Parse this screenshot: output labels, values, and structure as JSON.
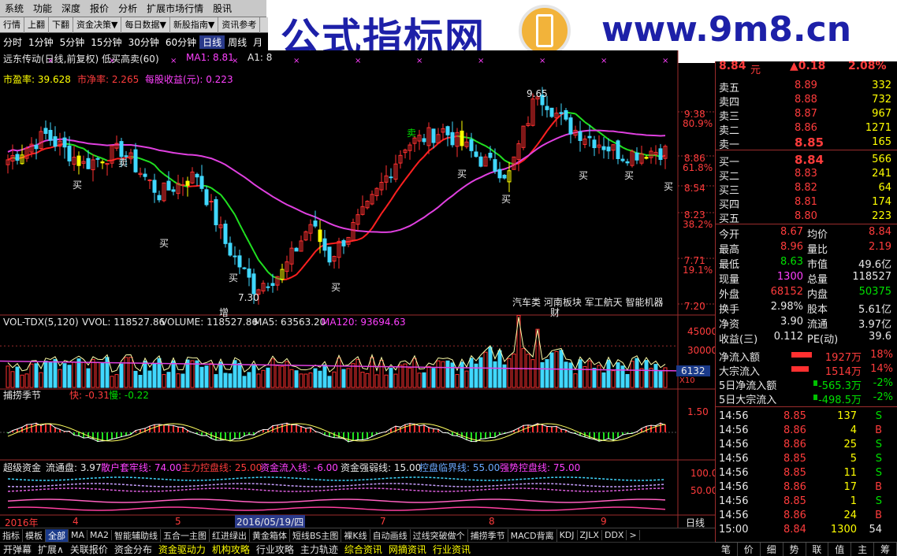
{
  "menubar": [
    "系统",
    "功能",
    "深度",
    "报价",
    "分析",
    "扩展市场行情",
    "股讯"
  ],
  "banner": {
    "title": "公式指标网",
    "url": "www.9m8.cn"
  },
  "toolbar": [
    "行情",
    "上翻",
    "下翻",
    "资金决策▼",
    "每日数据▼",
    "新股指南▼",
    "资讯参考"
  ],
  "periods": [
    "分时",
    "1分钟",
    "5分钟",
    "15分钟",
    "30分钟",
    "60分钟",
    "日线",
    "周线",
    "月"
  ],
  "active_period": "日线",
  "chart_header": {
    "title": "远东传动(日线,前复权) 低买高卖(60)",
    "ma1": "MA1: 8.81",
    "a1": "A1: 8",
    "pe": "市盈率: 39.628",
    "pb": "市净率: 2.265",
    "eps": "每股收益(元): 0.223"
  },
  "price_axis": [
    {
      "v": "9.38",
      "p": "80.9%"
    },
    {
      "v": "8.86",
      "p": "61.8%"
    },
    {
      "v": "8.54",
      "p": ""
    },
    {
      "v": "8.23",
      "p": "38.2%"
    },
    {
      "v": "7.71",
      "p": "19.1%"
    },
    {
      "v": "7.20",
      "p": ""
    }
  ],
  "annotations": {
    "high": "9.65",
    "low": "7.30",
    "sell": "卖",
    "buy": "买",
    "zeng": "增",
    "cai": "财",
    "sectors": "汽车类 河南板块 军工航天 智能机器"
  },
  "vol": {
    "title": "VOL-TDX(5,120)",
    "vvol": "VVOL: 118527.86",
    "volume": "VOLUME: 118527.86",
    "ma5": "MA5: 63563.20",
    "ma120": "MA120: 93694.63",
    "axis": [
      "45000",
      "30000"
    ],
    "current": "6132",
    "unit": "X10"
  },
  "season": {
    "title": "捕捞季节",
    "fast": "快: -0.31",
    "slow": "慢: -0.22",
    "axis": [
      "1.50"
    ]
  },
  "super": {
    "title": "超级资金",
    "float": "流通盘: 3.97",
    "l1": "散户套牢线: 74.00",
    "l2": "主力控盘线: 25.00",
    "l3": "资金流入线: -6.00",
    "l4": "资金强弱线: 15.00",
    "l5": "控盘临界线: 55.00",
    "l6": "强势控盘线: 75.00",
    "axis": [
      "100.0",
      "50.00"
    ]
  },
  "dates": {
    "year": "2016年",
    "m4": "4",
    "m5": "5",
    "cursor": "2016/05/19/四",
    "m7": "7",
    "m8": "8",
    "m9": "9",
    "period": "日线"
  },
  "chart_data": {
    "type": "candlestick",
    "title": "远东传动(日线,前复权) 低买高卖(60)",
    "ylim": [
      7.2,
      9.75
    ],
    "high": 9.65,
    "low": 7.3,
    "series": [
      {
        "name": "MA1",
        "last": 8.81
      }
    ]
  },
  "quote": {
    "price": "8.84",
    "unit": "元",
    "change": "▲0.18",
    "pct": "2.08%"
  },
  "asks": [
    {
      "l": "卖五",
      "p": "8.89",
      "v": "332"
    },
    {
      "l": "卖四",
      "p": "8.88",
      "v": "732"
    },
    {
      "l": "卖三",
      "p": "8.87",
      "v": "967"
    },
    {
      "l": "卖二",
      "p": "8.86",
      "v": "1271"
    },
    {
      "l": "卖一",
      "p": "8.85",
      "v": "165"
    }
  ],
  "bids": [
    {
      "l": "买一",
      "p": "8.84",
      "v": "566"
    },
    {
      "l": "买二",
      "p": "8.83",
      "v": "241"
    },
    {
      "l": "买三",
      "p": "8.82",
      "v": "64"
    },
    {
      "l": "买四",
      "p": "8.81",
      "v": "174"
    },
    {
      "l": "买五",
      "p": "8.80",
      "v": "223"
    }
  ],
  "stats": [
    {
      "a": "今开",
      "b": "8.67",
      "c": "均价",
      "d": "8.84"
    },
    {
      "a": "最高",
      "b": "8.96",
      "c": "量比",
      "d": "2.19"
    },
    {
      "a": "最低",
      "b": "8.63",
      "c": "市值",
      "d": "49.6亿"
    },
    {
      "a": "现量",
      "b": "1300",
      "c": "总量",
      "d": "118527"
    },
    {
      "a": "外盘",
      "b": "68152",
      "c": "内盘",
      "d": "50375"
    },
    {
      "a": "换手",
      "b": "2.98%",
      "c": "股本",
      "d": "5.61亿"
    },
    {
      "a": "净资",
      "b": "3.90",
      "c": "流通",
      "d": "3.97亿"
    },
    {
      "a": "收益(三)",
      "b": "0.112",
      "c": "PE(动)",
      "d": "39.6"
    }
  ],
  "flows": [
    {
      "l": "净流入额",
      "v": "1927万",
      "p": "18%"
    },
    {
      "l": "大宗流入",
      "v": "1514万",
      "p": "14%"
    },
    {
      "l": "5日净流入额",
      "v": "-565.3万",
      "p": "-2%"
    },
    {
      "l": "5日大宗流入",
      "v": "-498.5万",
      "p": "-2%"
    }
  ],
  "ticks": [
    {
      "t": "14:56",
      "p": "8.85",
      "v": "137",
      "s": "S"
    },
    {
      "t": "14:56",
      "p": "8.86",
      "v": "4",
      "s": "B"
    },
    {
      "t": "14:56",
      "p": "8.86",
      "v": "25",
      "s": "S"
    },
    {
      "t": "14:56",
      "p": "8.85",
      "v": "5",
      "s": "S"
    },
    {
      "t": "14:56",
      "p": "8.85",
      "v": "11",
      "s": "S"
    },
    {
      "t": "14:56",
      "p": "8.86",
      "v": "17",
      "s": "B"
    },
    {
      "t": "14:56",
      "p": "8.85",
      "v": "1",
      "s": "S"
    },
    {
      "t": "14:56",
      "p": "8.86",
      "v": "24",
      "s": "B"
    },
    {
      "t": "15:00",
      "p": "8.84",
      "v": "1300",
      "s": "54"
    }
  ],
  "bottom_tabs": [
    "指标",
    "模板",
    "全部",
    "MA",
    "MA2",
    "智能辅助线",
    "五合一主图",
    "红进绿出",
    "黄金箱体",
    "短线BS主图",
    "裸K线",
    "自动画线",
    "过线突破做个",
    "捕捞季节",
    "MACD背离",
    "KDJ",
    "ZJLX",
    "DDX",
    ">"
  ],
  "bottom_tabs2": [
    "开弹幕",
    "扩展∧",
    "关联报价",
    "资金分布",
    "资金驱动力",
    "机构攻略",
    "行业攻略",
    "主力轨迹",
    "综合资讯",
    "网摘资讯",
    "行业资讯"
  ],
  "rp_tabs": [
    "笔",
    "价",
    "细",
    "势",
    "联",
    "值",
    "主",
    "筹"
  ]
}
